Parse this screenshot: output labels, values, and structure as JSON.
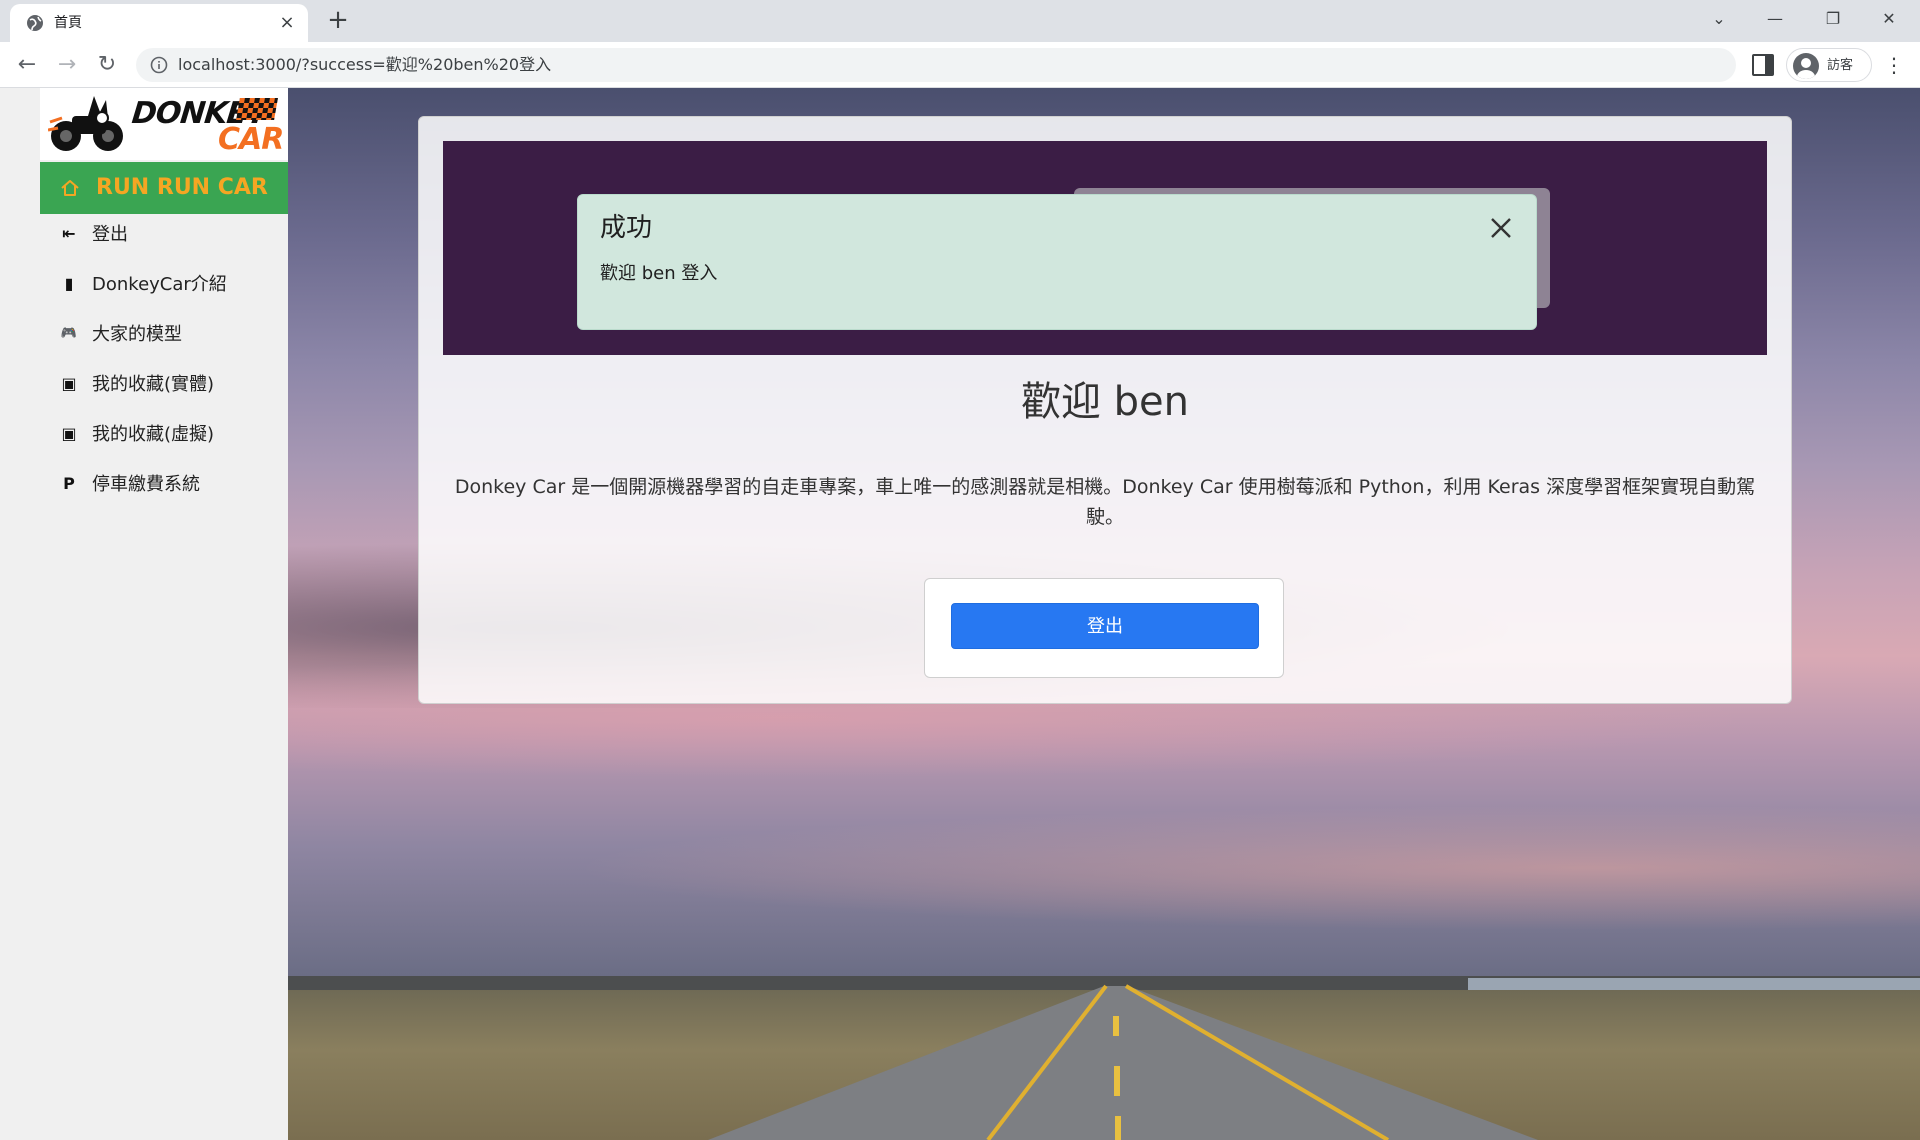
{
  "browser": {
    "tab_title": "首頁",
    "url": "localhost:3000/?success=歡迎%20ben%20登入",
    "profile_label": "訪客",
    "new_tab_symbol": "+",
    "close_tab_symbol": "×",
    "window_controls": {
      "tab_search": "⌄",
      "minimize": "—",
      "restore": "❐",
      "close": "✕"
    },
    "nav": {
      "back": "←",
      "forward": "→",
      "reload": "↻"
    },
    "menu_symbol": "⋮"
  },
  "sidebar": {
    "logo": {
      "word1": "DONKEY",
      "word2": "CAR"
    },
    "home": {
      "label": "RUN RUN CAR",
      "icon": "home-icon"
    },
    "items": [
      {
        "label": "登出",
        "icon": "sign-out-icon",
        "glyph": "⇤"
      },
      {
        "label": "DonkeyCar介紹",
        "icon": "document-icon",
        "glyph": "▮"
      },
      {
        "label": "大家的模型",
        "icon": "gamepad-icon",
        "glyph": "🎮"
      },
      {
        "label": "我的收藏(實體)",
        "icon": "bag-icon",
        "glyph": "▣"
      },
      {
        "label": "我的收藏(虛擬)",
        "icon": "bag-icon",
        "glyph": "▣"
      },
      {
        "label": "停車繳費系統",
        "icon": "parking-icon",
        "glyph": "P"
      }
    ]
  },
  "alert": {
    "title": "成功",
    "message": "歡迎 ben 登入"
  },
  "main": {
    "welcome": "歡迎 ben",
    "intro": "Donkey Car 是一個開源機器學習的自走車專案，車上唯一的感測器就是相機。Donkey Car 使用樹莓派和 Python，利用 Keras 深度學習框架實現自動駕駛。",
    "logout_button": "登出"
  },
  "colors": {
    "sidebar_home_bg": "#3aa552",
    "sidebar_home_text": "#f5a623",
    "banner_bg": "#3b1d45",
    "alert_bg": "#d1e7dd",
    "button_primary": "#2778f2",
    "logo_accent": "#f36f21"
  }
}
